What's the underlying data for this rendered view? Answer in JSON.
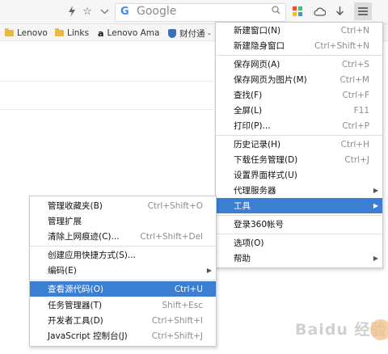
{
  "toolbar": {
    "icons": [
      "lightning-icon",
      "star-icon",
      "chevron-down-icon",
      "google-icon",
      "search-icon",
      "apps-icon",
      "cloud-icon",
      "download-icon",
      "menu-icon"
    ],
    "search": {
      "logo": "G",
      "placeholder": "Google"
    }
  },
  "bookmarks": [
    {
      "label": "Lenovo",
      "icon": "folder-icon"
    },
    {
      "label": "Links",
      "icon": "folder-icon"
    },
    {
      "label": "Lenovo Ama",
      "icon": "amazon-icon"
    },
    {
      "label": "财付通 -",
      "icon": "shield-icon"
    }
  ],
  "main_menu": {
    "items": [
      {
        "label": "新建窗口(N)",
        "shortcut": "Ctrl+N"
      },
      {
        "label": "新建隐身窗口",
        "shortcut": "Ctrl+Shift+N"
      },
      {
        "label": "保存网页(A)",
        "shortcut": "Ctrl+S"
      },
      {
        "label": "保存网页为图片(M)",
        "shortcut": "Ctrl+M"
      },
      {
        "label": "查找(F)",
        "shortcut": "Ctrl+F"
      },
      {
        "label": "全屏(L)",
        "shortcut": "F11"
      },
      {
        "label": "打印(P)...",
        "shortcut": "Ctrl+P"
      },
      {
        "label": "历史记录(H)",
        "shortcut": "Ctrl+H"
      },
      {
        "label": "下载任务管理(D)",
        "shortcut": "Ctrl+J"
      },
      {
        "label": "设置界面样式(U)",
        "shortcut": ""
      },
      {
        "label": "代理服务器",
        "shortcut": ""
      },
      {
        "label": "工具",
        "shortcut": ""
      },
      {
        "label": "登录360帐号",
        "shortcut": ""
      },
      {
        "label": "选项(O)",
        "shortcut": ""
      },
      {
        "label": "帮助",
        "shortcut": ""
      }
    ]
  },
  "sub_menu": {
    "items": [
      {
        "label": "管理收藏夹(B)",
        "shortcut": "Ctrl+Shift+O"
      },
      {
        "label": "管理扩展",
        "shortcut": ""
      },
      {
        "label": "清除上网痕迹(C)...",
        "shortcut": "Ctrl+Shift+Del"
      },
      {
        "label": "创建应用快捷方式(S)...",
        "shortcut": ""
      },
      {
        "label": "编码(E)",
        "shortcut": ""
      },
      {
        "label": "查看源代码(O)",
        "shortcut": "Ctrl+U"
      },
      {
        "label": "任务管理器(T)",
        "shortcut": "Shift+Esc"
      },
      {
        "label": "开发者工具(D)",
        "shortcut": "Ctrl+Shift+I"
      },
      {
        "label": "JavaScript 控制台(J)",
        "shortcut": "Ctrl+Shift+J"
      }
    ]
  },
  "colors": {
    "highlight": "#3a7fd1",
    "menu_border": "#c9c9c9",
    "shortcut_text": "#8e8e8e"
  },
  "watermark": "Baidu 经验"
}
